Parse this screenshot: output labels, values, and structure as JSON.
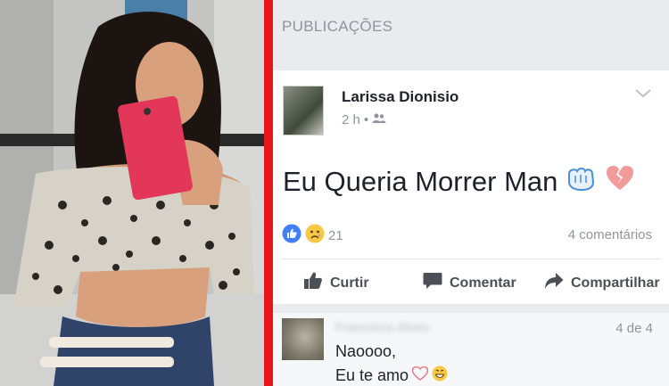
{
  "feed": {
    "section_label": "PUBLICAÇÕES",
    "post": {
      "author": "Larissa Dionisio",
      "time": "2 h",
      "audience_icon": "friends-icon",
      "text": "Eu Queria Morrer Man",
      "reaction_count": "21",
      "comments_label": "4 comentários",
      "actions": {
        "like": "Curtir",
        "comment": "Comentar",
        "share": "Compartilhar"
      }
    },
    "comment": {
      "author": "Francisca Alves",
      "page_indicator": "4 de 4",
      "line1": "Naoooo,",
      "line2": "Eu te amo"
    }
  },
  "colors": {
    "divider": "#e8161b",
    "like_blue": "#4080ff",
    "text_dark": "#1d2129",
    "text_muted": "#90949c"
  }
}
